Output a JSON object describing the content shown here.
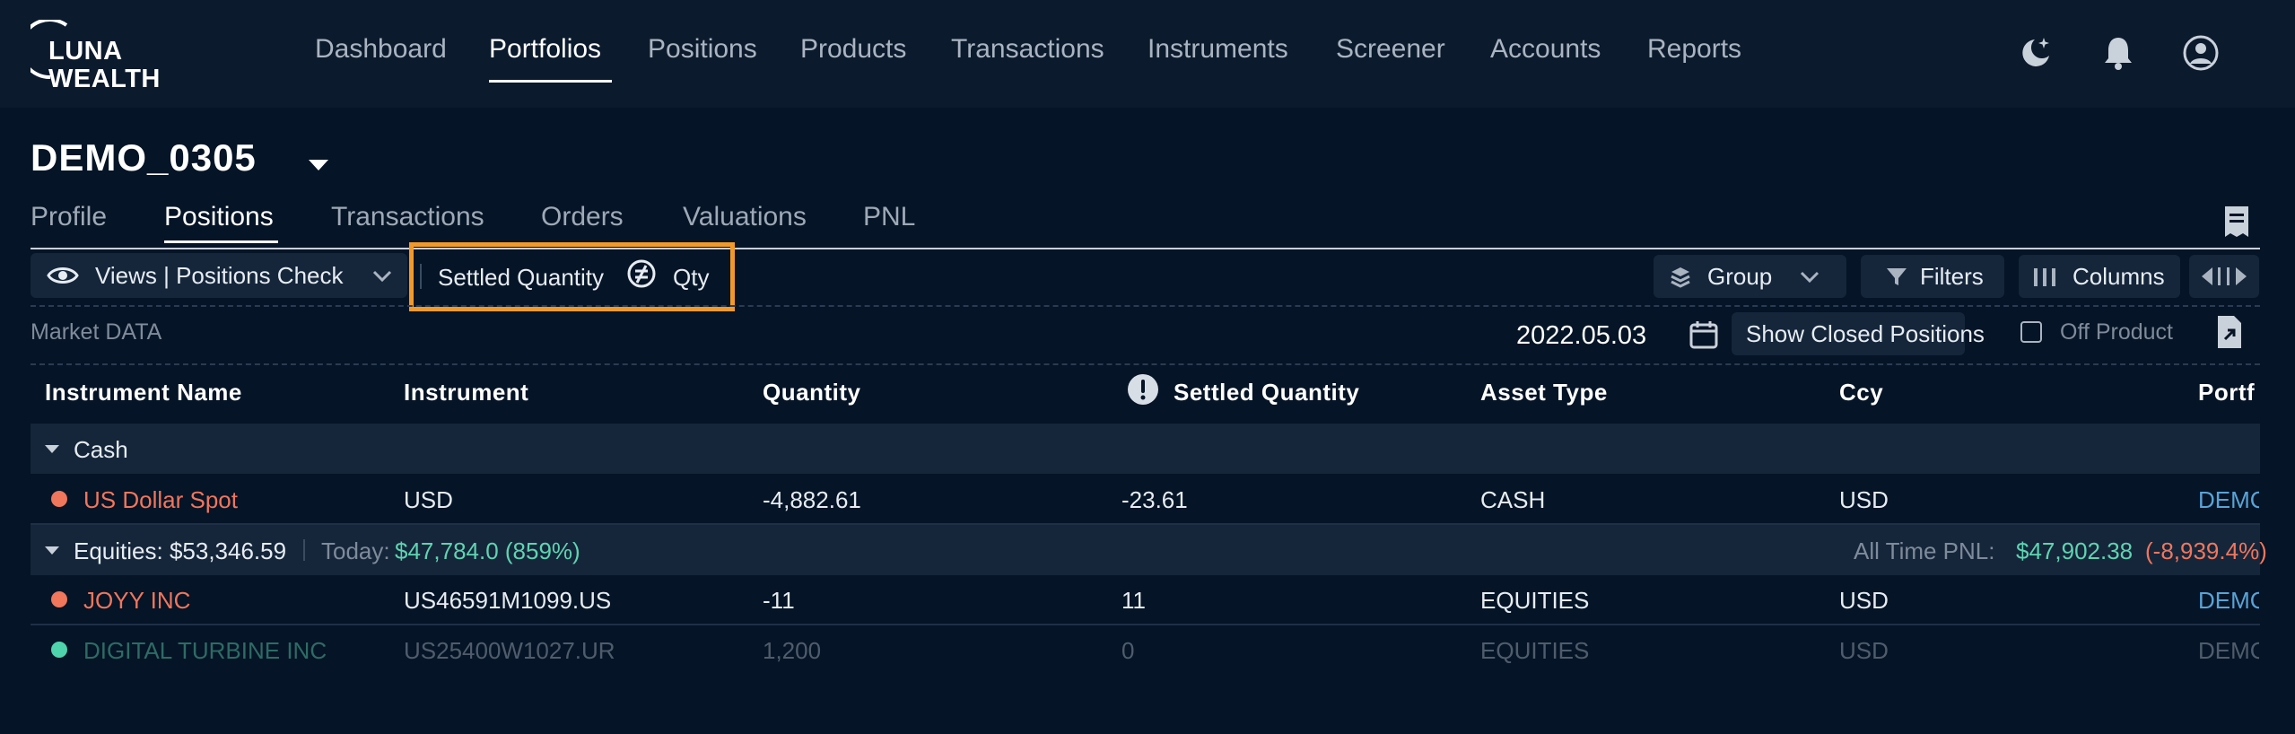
{
  "app": {
    "logo_line1": "LUNA",
    "logo_line2": "WEALTH"
  },
  "nav": {
    "items": [
      "Dashboard",
      "Portfolios",
      "Positions",
      "Products",
      "Transactions",
      "Instruments",
      "Screener",
      "Accounts",
      "Reports"
    ],
    "active": "Portfolios",
    "icons": [
      "moon-star-icon",
      "bell-icon",
      "user-circle-icon"
    ]
  },
  "portfolio": {
    "name": "DEMO_0305"
  },
  "tabs": {
    "items": [
      "Profile",
      "Positions",
      "Transactions",
      "Orders",
      "Valuations",
      "PNL"
    ],
    "active": "Positions"
  },
  "toolbar": {
    "views_label": "Views | Positions Check",
    "settled_label": "Settled Quantity",
    "qty_label": "Qty",
    "group_label": "Group",
    "filters_label": "Filters",
    "columns_label": "Columns"
  },
  "subbar": {
    "market_data": "Market DATA",
    "date": "2022.05.03",
    "show_closed": "Show Closed Positions",
    "off_product": "Off Product",
    "off_product_checked": false
  },
  "table": {
    "headers": [
      "Instrument Name",
      "Instrument",
      "Quantity",
      "Settled Quantity",
      "Asset Type",
      "Ccy",
      "Portf"
    ],
    "groups": [
      {
        "label": "Cash",
        "rows": [
          {
            "name": "US Dollar Spot",
            "instrument": "USD",
            "quantity": "-4,882.61",
            "settled": "-23.61",
            "asset": "CASH",
            "ccy": "USD",
            "portfolio": "DEMC",
            "status": "warning"
          }
        ]
      },
      {
        "label": "Equities: $53,346.59",
        "today_label": "Today:",
        "today_value": "$47,784.0 (859%)",
        "pnl_label": "All Time PNL:",
        "pnl_value": "$47,902.38",
        "pnl_pct": "(-8,939.4%)",
        "rows": [
          {
            "name": "JOYY INC",
            "instrument": "US46591M1099.US",
            "quantity": "-11",
            "settled": "11",
            "asset": "EQUITIES",
            "ccy": "USD",
            "portfolio": "DEMC",
            "status": "warning"
          },
          {
            "name": "DIGITAL TURBINE INC",
            "instrument": "US25400W1027.UR",
            "quantity": "1,200",
            "settled": "0",
            "asset": "EQUITIES",
            "ccy": "USD",
            "portfolio": "DEMC",
            "status": "ok"
          }
        ]
      }
    ]
  },
  "colors": {
    "accent_orange": "#f29a29",
    "positive": "#5fd4b0",
    "negative": "#f0765c",
    "warning_dot": "#f0765c",
    "ok_dot": "#4fd3ac"
  }
}
